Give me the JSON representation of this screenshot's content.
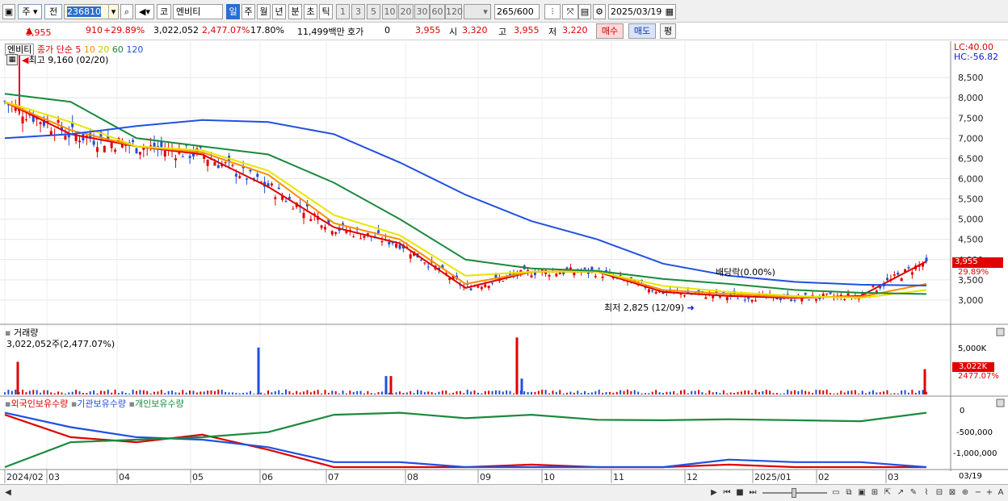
{
  "toolbar": {
    "mode": "주",
    "prev_label": "전",
    "code": "236810",
    "market": "코",
    "name": "엔비티",
    "periods": [
      "일",
      "주",
      "월",
      "년",
      "분",
      "초",
      "틱"
    ],
    "minutes": [
      "1",
      "3",
      "5",
      "10",
      "20",
      "30",
      "60",
      "120"
    ],
    "count": "265",
    "total": "/600",
    "date": "2025/03/19"
  },
  "info": {
    "price": "3,955",
    "change": "910",
    "change_pct": "+29.89%",
    "volume": "3,022,052",
    "volume_pct": "2,477.07%",
    "turnover_pct": "17.80%",
    "amount": "11,499백만",
    "quote_label": "호가",
    "quote_value": "0",
    "price2": "3,955",
    "open_label": "시",
    "open": "3,320",
    "high_label": "고",
    "high": "3,955",
    "low_label": "저",
    "low": "3,220",
    "buy_label": "매수",
    "sell_label": "매도",
    "avg_label": "평"
  },
  "price_panel": {
    "legend_name": "엔비티",
    "legend_ma": "종가 단순",
    "ma_periods": [
      "5",
      "10",
      "20",
      "60",
      "120"
    ],
    "ma_colors": [
      "#e00000",
      "#ff8c00",
      "#e6e600",
      "#1a8a3c",
      "#2050e0"
    ],
    "high_note": "최고 9,160 (02/20)",
    "low_note": "최저 2,825 (12/09)",
    "dividend_note": "배당락(0.00%)",
    "lc": "LC:40.00",
    "hc": "HC:-56.82",
    "y_ticks": [
      "8,500",
      "8,000",
      "7,500",
      "7,000",
      "6,500",
      "6,000",
      "5,500",
      "5,000",
      "4,500",
      "4,000",
      "3,500",
      "3,000"
    ],
    "last_price": "3,955",
    "last_pct": "29.89%"
  },
  "volume_panel": {
    "title": "거래량",
    "value_label": "3,022,052주(2,477.07%)",
    "y_ticks": [
      "5,000K"
    ],
    "last_value": "3,022K",
    "last_pct": "2477.07%"
  },
  "holding_panel": {
    "legend": [
      "외국인보유수량",
      "기관보유수량",
      "개인보유수량"
    ],
    "legend_colors": [
      "#e00000",
      "#2050e0",
      "#1a8a3c"
    ],
    "y_ticks": [
      "0",
      "-500,000",
      "-1,000,000"
    ]
  },
  "x_axis": {
    "labels": [
      "2024/02",
      "03",
      "04",
      "05",
      "06",
      "07",
      "08",
      "09",
      "10",
      "11",
      "12",
      "2025/01",
      "02",
      "03"
    ],
    "right_label": "03/19"
  },
  "chart_data": {
    "type": "line",
    "title": "엔비티",
    "months": [
      "2024/02",
      "2024/03",
      "2024/04",
      "2024/05",
      "2024/06",
      "2024/07",
      "2024/08",
      "2024/09",
      "2024/10",
      "2024/11",
      "2024/12",
      "2025/01",
      "2025/02",
      "2025/03",
      "2025/03/19"
    ],
    "series": [
      {
        "name": "5",
        "color": "#e00000",
        "values": [
          7900,
          7100,
          6800,
          6600,
          5800,
          4800,
          4400,
          3300,
          3700,
          3700,
          3200,
          3100,
          3050,
          3100,
          3955
        ]
      },
      {
        "name": "10",
        "color": "#ff8c00",
        "values": [
          7900,
          7200,
          6800,
          6650,
          6100,
          4900,
          4500,
          3400,
          3700,
          3720,
          3250,
          3150,
          3070,
          3080,
          3400
        ]
      },
      {
        "name": "20",
        "color": "#e6e600",
        "values": [
          7900,
          7400,
          6800,
          6700,
          6200,
          5100,
          4600,
          3600,
          3700,
          3700,
          3350,
          3200,
          3100,
          3050,
          3250
        ]
      },
      {
        "name": "60",
        "color": "#1a8a3c",
        "values": [
          8100,
          7900,
          7000,
          6800,
          6600,
          5900,
          5000,
          4000,
          3780,
          3720,
          3520,
          3400,
          3250,
          3180,
          3150
        ]
      },
      {
        "name": "120",
        "color": "#2050e0",
        "values": [
          7000,
          7100,
          7300,
          7450,
          7400,
          7100,
          6400,
          5600,
          4950,
          4500,
          3900,
          3600,
          3450,
          3380,
          3360
        ]
      }
    ],
    "ylim": [
      2400,
      9400
    ],
    "high": {
      "value": 9160,
      "date": "02/20"
    },
    "low": {
      "value": 2825,
      "date": "12/09"
    },
    "volume_spikes": [
      {
        "month": "2024/02",
        "volume": 3900000,
        "color": "#e00000"
      },
      {
        "month": "2024/06",
        "volume": 5600000,
        "color": "#2050e0"
      },
      {
        "month": "2024/08",
        "volume": 2200000,
        "color": "#2050e0"
      },
      {
        "month": "2024/08",
        "volume": 2200000,
        "color": "#e00000"
      },
      {
        "month": "2024/10",
        "volume": 6800000,
        "color": "#e00000"
      },
      {
        "month": "2024/10",
        "volume": 1900000,
        "color": "#2050e0"
      },
      {
        "month": "2025/03",
        "volume": 3022052,
        "color": "#e00000"
      }
    ]
  }
}
